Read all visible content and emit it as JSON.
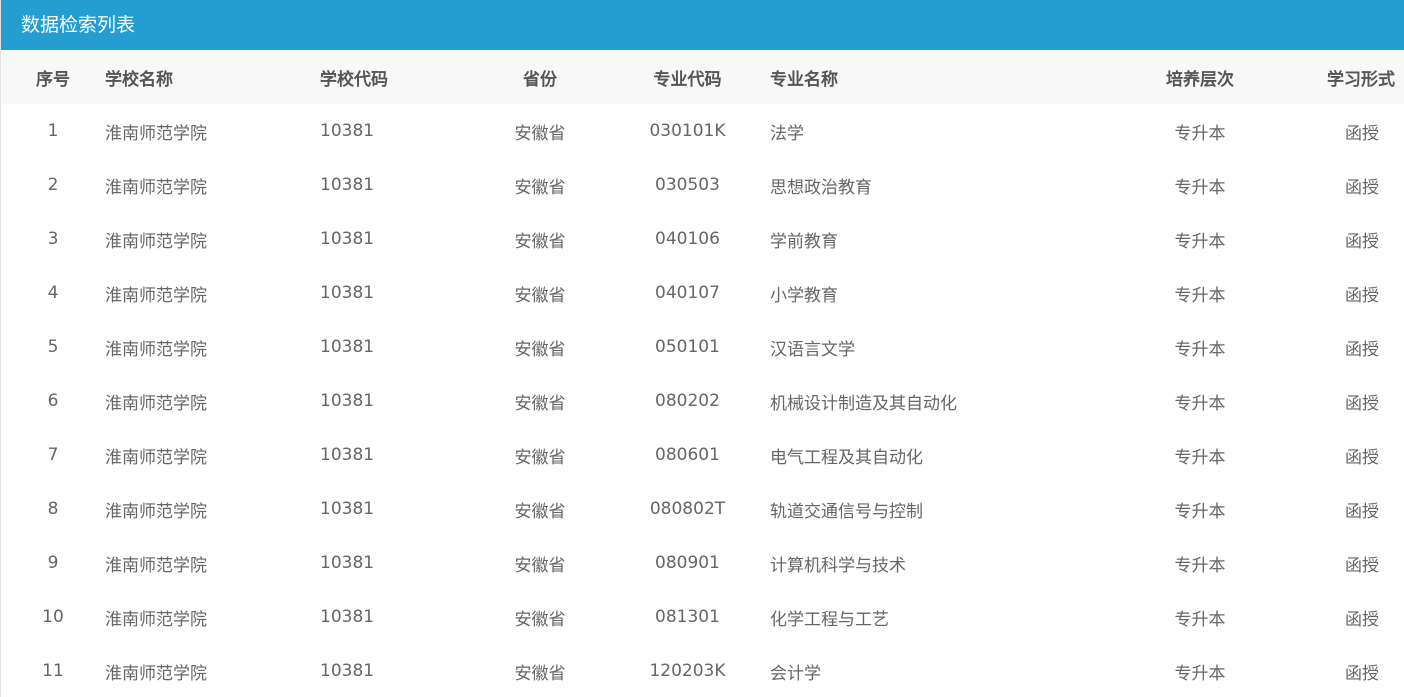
{
  "panel": {
    "title": "数据检索列表"
  },
  "table": {
    "headers": {
      "index": "序号",
      "school_name": "学校名称",
      "school_code": "学校代码",
      "province": "省份",
      "major_code": "专业代码",
      "major_name": "专业名称",
      "level": "培养层次",
      "study_form": "学习形式"
    },
    "rows": [
      {
        "index": "1",
        "school_name": "淮南师范学院",
        "school_code": "10381",
        "province": "安徽省",
        "major_code": "030101K",
        "major_name": "法学",
        "level": "专升本",
        "study_form": "函授"
      },
      {
        "index": "2",
        "school_name": "淮南师范学院",
        "school_code": "10381",
        "province": "安徽省",
        "major_code": "030503",
        "major_name": "思想政治教育",
        "level": "专升本",
        "study_form": "函授"
      },
      {
        "index": "3",
        "school_name": "淮南师范学院",
        "school_code": "10381",
        "province": "安徽省",
        "major_code": "040106",
        "major_name": "学前教育",
        "level": "专升本",
        "study_form": "函授"
      },
      {
        "index": "4",
        "school_name": "淮南师范学院",
        "school_code": "10381",
        "province": "安徽省",
        "major_code": "040107",
        "major_name": "小学教育",
        "level": "专升本",
        "study_form": "函授"
      },
      {
        "index": "5",
        "school_name": "淮南师范学院",
        "school_code": "10381",
        "province": "安徽省",
        "major_code": "050101",
        "major_name": "汉语言文学",
        "level": "专升本",
        "study_form": "函授"
      },
      {
        "index": "6",
        "school_name": "淮南师范学院",
        "school_code": "10381",
        "province": "安徽省",
        "major_code": "080202",
        "major_name": "机械设计制造及其自动化",
        "level": "专升本",
        "study_form": "函授"
      },
      {
        "index": "7",
        "school_name": "淮南师范学院",
        "school_code": "10381",
        "province": "安徽省",
        "major_code": "080601",
        "major_name": "电气工程及其自动化",
        "level": "专升本",
        "study_form": "函授"
      },
      {
        "index": "8",
        "school_name": "淮南师范学院",
        "school_code": "10381",
        "province": "安徽省",
        "major_code": "080802T",
        "major_name": "轨道交通信号与控制",
        "level": "专升本",
        "study_form": "函授"
      },
      {
        "index": "9",
        "school_name": "淮南师范学院",
        "school_code": "10381",
        "province": "安徽省",
        "major_code": "080901",
        "major_name": "计算机科学与技术",
        "level": "专升本",
        "study_form": "函授"
      },
      {
        "index": "10",
        "school_name": "淮南师范学院",
        "school_code": "10381",
        "province": "安徽省",
        "major_code": "081301",
        "major_name": "化学工程与工艺",
        "level": "专升本",
        "study_form": "函授"
      },
      {
        "index": "11",
        "school_name": "淮南师范学院",
        "school_code": "10381",
        "province": "安徽省",
        "major_code": "120203K",
        "major_name": "会计学",
        "level": "专升本",
        "study_form": "函授"
      }
    ]
  },
  "colors": {
    "header_bar": "#259dd0",
    "header_text": "#ffffff",
    "column_header_bg": "#f8f8f8",
    "text": "#666666"
  }
}
